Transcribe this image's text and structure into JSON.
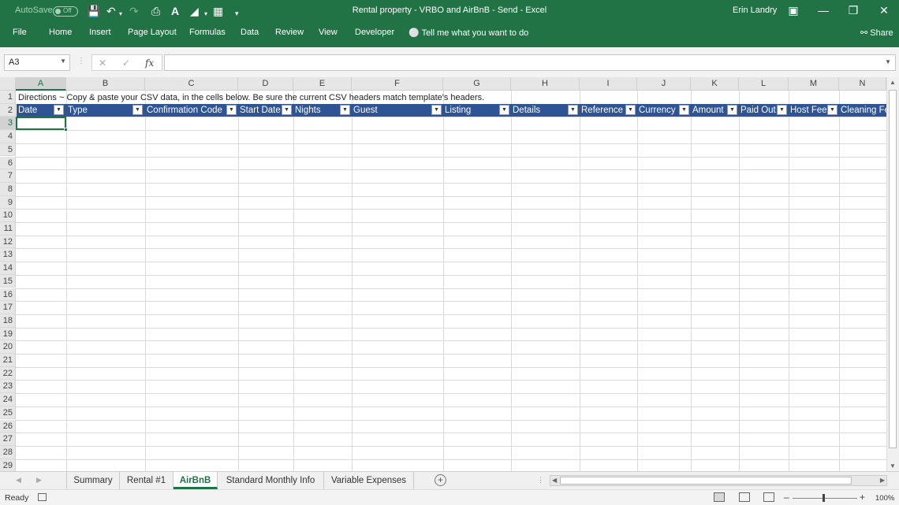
{
  "window": {
    "title": "Rental property - VRBO and AirBnB - Send  -  Excel",
    "autosave_label": "AutoSave",
    "autosave_state": "Off",
    "user": "Erin Landry"
  },
  "ribbon": {
    "file": "File",
    "tabs": [
      "Home",
      "Insert",
      "Page Layout",
      "Formulas",
      "Data",
      "Review",
      "View",
      "Developer"
    ],
    "tell_me": "Tell me what you want to do",
    "share": "Share"
  },
  "formula_bar": {
    "name_box": "A3",
    "formula": "",
    "fx_label": "fx"
  },
  "sheet": {
    "columns": [
      "A",
      "B",
      "C",
      "D",
      "E",
      "F",
      "G",
      "H",
      "I",
      "J",
      "K",
      "L",
      "M",
      "N"
    ],
    "rows": [
      "1",
      "2",
      "3",
      "4",
      "5",
      "6",
      "7",
      "8",
      "9",
      "10",
      "11",
      "12",
      "13",
      "14",
      "15",
      "16",
      "17",
      "18",
      "19",
      "20",
      "21",
      "22",
      "23",
      "24",
      "25",
      "26",
      "27",
      "28",
      "29"
    ],
    "directions": "Directions ~ Copy & paste your CSV data, in the cells below.  Be sure the current CSV headers match template's headers.",
    "headers": [
      "Date",
      "Type",
      "Confirmation Code",
      "Start Date",
      "Nights",
      "Guest",
      "Listing",
      "Details",
      "Reference",
      "Currency",
      "Amount",
      "Paid Out",
      "Host Fee",
      "Cleaning Fe"
    ],
    "header_color": "#2f5496",
    "active_cell": "A3"
  },
  "sheet_tabs": {
    "tabs": [
      "Summary",
      "Rental #1",
      "AirBnB",
      "Standard Monthly Info",
      "Variable Expenses"
    ],
    "active": "AirBnB"
  },
  "status": {
    "ready": "Ready",
    "zoom": "100%"
  },
  "colors": {
    "accent": "#217346"
  }
}
